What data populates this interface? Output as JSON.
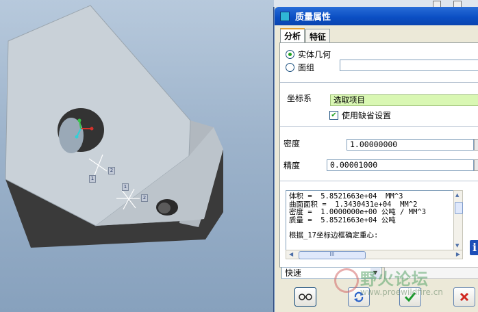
{
  "dialog": {
    "title": "质量属性",
    "tabs": [
      {
        "label": "分析",
        "active": true
      },
      {
        "label": "特征",
        "active": false
      }
    ],
    "geometry_options": [
      {
        "label": "实体几何",
        "selected": true
      },
      {
        "label": "面组",
        "selected": false
      }
    ],
    "coordinate_system": {
      "label": "坐标系",
      "value": "选取项目",
      "use_default_label": "使用缺省设置",
      "use_default_checked": true
    },
    "density": {
      "label": "密度",
      "value": "1.00000000"
    },
    "precision": {
      "label": "精度",
      "value": "0.00001000"
    },
    "results": [
      "体积 =  5.8521663e+04  MM^3",
      "曲面面积 =  1.3430431e+04  MM^2",
      "密度 =  1.0000000e+00 公吨 / MM^3",
      "质量 =  5.8521663e+04 公吨",
      "",
      "根据_17坐标边框确定重心:"
    ],
    "scroll_thumb_label": "III",
    "mode_select": {
      "value": "快速"
    },
    "buttons": [
      {
        "name": "preview-button",
        "icon": "glasses-icon"
      },
      {
        "name": "repeat-button",
        "icon": "refresh-icon"
      },
      {
        "name": "ok-button",
        "icon": "checkmark-icon"
      },
      {
        "name": "cancel-button",
        "icon": "close-icon"
      }
    ]
  },
  "model_labels": {
    "csys_tag_1": "1",
    "csys_tag_2": "2",
    "csys_tag_3": "1",
    "csys_tag_4": "2"
  },
  "watermark": {
    "title": "野火论坛",
    "url": "www.proewildfire.cn"
  },
  "colors": {
    "title_bar": "#0b4fc4",
    "coord_highlight": "#d9f7b3",
    "dialog_bg": "#ece9d8"
  }
}
